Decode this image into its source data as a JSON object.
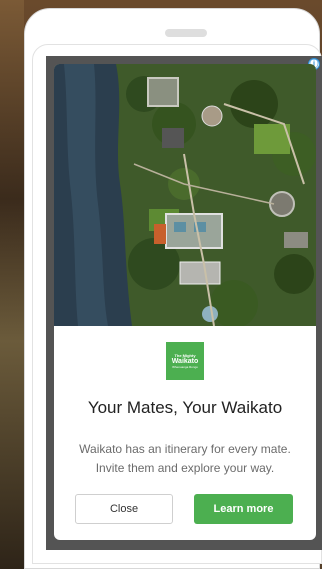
{
  "ad": {
    "info_icon": "ⓘ",
    "headline": "Your Mates, Your Waikato",
    "description": "Waikato has an itinerary for every mate. Invite them and explore your way.",
    "logo": {
      "line1": "The Mighty",
      "line2": "Waikato",
      "line3": "Whenuanga Rongo"
    },
    "buttons": {
      "close": "Close",
      "learn_more": "Learn more"
    },
    "colors": {
      "accent": "#4caf50",
      "info": "#2d8fd6"
    },
    "image": {
      "subject": "aerial-garden-photo"
    }
  }
}
